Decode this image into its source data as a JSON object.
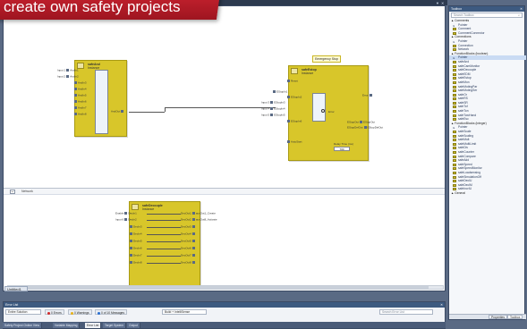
{
  "banner": {
    "text": "create own safety projects"
  },
  "editor": {
    "tab_label": "Untitled1",
    "network_label": "Network",
    "fb1": {
      "name": "safeAnd",
      "type": "Instance",
      "pins_in": [
        "Input 1",
        "Input 2",
        "Input3",
        "Input4",
        "Input5",
        "Input6",
        "Input7",
        "Input8"
      ],
      "pin_labels": [
        "AndIn1",
        "AndIn2",
        "AndIn3",
        "AndIn4",
        "AndIn5",
        "AndIn6",
        "AndIn7",
        "AndIn8"
      ],
      "out": "AndOut"
    },
    "fb2": {
      "title_box": "Emergency Stop",
      "name": "safeEstop",
      "type": "Instance",
      "pins_in": [
        "Reset",
        "EStopIn1",
        "EStopIn2",
        "EStopIn3",
        "EStopIn4",
        "EStopIn5",
        "EStopIn6",
        "AutoStart"
      ],
      "ext_in": [
        "Input 3",
        "Input 4",
        "Input 5"
      ],
      "out_pins": [
        "Error",
        "EStopOut",
        "EStopDelOut"
      ],
      "delay_label": "Delay Time (ms)",
      "delay_value": "T#0",
      "out_names": [
        "EStopOut",
        "EStopDelOut"
      ],
      "mid_label": "Error"
    },
    "fb3": {
      "name": "safeDecouple",
      "type": "Instance",
      "pins_in": [
        "Enable",
        "Input 6",
        "",
        "",
        "",
        "",
        "",
        ""
      ],
      "pin_labels": [
        "DecIn1",
        "DecIn2",
        "DecIn3",
        "DecIn4",
        "DecIn5",
        "DecIn6",
        "DecIn7",
        "DecIn8"
      ],
      "out_labels": [
        "DecOut1",
        "DecOut2",
        "DecOut3",
        "DecOut4",
        "DecOut5",
        "DecOut6",
        "DecOut7",
        "DecOut8"
      ],
      "out_names": [
        "auxOut1_Create",
        "auxOut8_Activate"
      ]
    }
  },
  "toolbox": {
    "title": "Toolbox",
    "search_placeholder": "Search Toolbox",
    "categories": [
      {
        "label": "Comments",
        "items": [
          "Pointer",
          "Comment",
          "CommentConnector"
        ]
      },
      {
        "label": "Connections",
        "items": [
          "Pointer",
          "Connection",
          "Network"
        ]
      },
      {
        "label": "FunctionBlocks (boolean)",
        "items": [
          "Pointer",
          "safeAnd",
          "safeCamMonitor",
          "safeDecouple",
          "safeEDM",
          "safeEstop",
          "safeMon",
          "safeMutingPar",
          "safeMutingSer",
          "safeOr",
          "safeRS",
          "safeSR",
          "safeTof",
          "safeTon",
          "safeTwoHand",
          "safeEsc"
        ]
      },
      {
        "label": "FunctionBlocks (integer)",
        "items": [
          "Pointer",
          "safeScale",
          "safeScaling",
          "safeMult",
          "safeMultiLimit",
          "safeDiv",
          "safeCounter",
          "safeCompare",
          "safeAdd",
          "safeSpeed",
          "safeSpeedMonitor",
          "safeLoadsensing",
          "safeSimulationOff",
          "safeDecIU",
          "safeDecIM",
          "safeIncrIU"
        ]
      },
      {
        "label": "General",
        "items": []
      }
    ],
    "tabs": [
      "Properties",
      "Toolbox"
    ]
  },
  "error_list": {
    "title": "Error List",
    "scope": "Entire Solution",
    "errors": "0 Errors",
    "warnings": "0 Warnings",
    "messages": "0 of 10 Messages",
    "build_filter": "Build + IntelliSense",
    "search_placeholder": "Search Error List"
  },
  "bottom_tabs": [
    "Safety Project Online View",
    "Variable Mapping",
    "Error List",
    "Target System",
    "Output"
  ],
  "top_controls": [
    "▼",
    "✕"
  ]
}
